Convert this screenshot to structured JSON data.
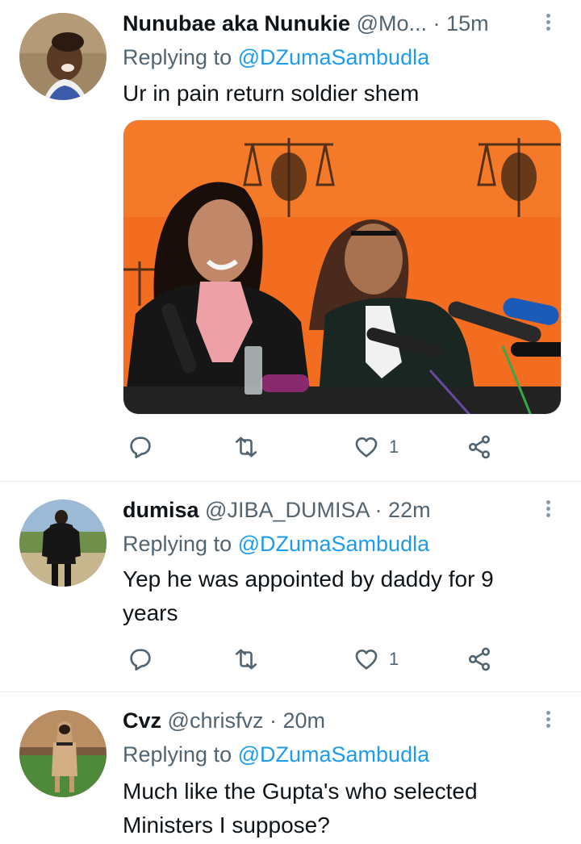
{
  "tweets": [
    {
      "name": "Nunubae aka Nunukie",
      "handle": "@Mo...",
      "dot": " ·",
      "time": "15m",
      "replying_prefix": "Replying to ",
      "replying_to": "@DZumaSambudla",
      "text": "Ur in pain return soldier shem",
      "has_media": true,
      "likes": "1"
    },
    {
      "name": "dumisa",
      "handle": "@JIBA_DUMISA",
      "dot": " ·",
      "time": "22m",
      "replying_prefix": "Replying to ",
      "replying_to": "@DZumaSambudla",
      "text": "Yep he was appointed by daddy for 9 years",
      "has_media": false,
      "likes": "1"
    },
    {
      "name": "Cvz",
      "handle": "@chrisfvz",
      "dot": " ·",
      "time": "20m",
      "replying_prefix": "Replying to ",
      "replying_to": "@DZumaSambudla",
      "text": "Much like the Gupta's who selected Ministers I suppose?",
      "has_media": false
    }
  ],
  "icons": {
    "reply": "reply-icon",
    "retweet": "retweet-icon",
    "like": "heart-icon",
    "share": "share-icon",
    "more": "more-vertical-icon"
  },
  "colors": {
    "accent": "#1d9bf0",
    "secondary_text": "#536471",
    "primary_text": "#0f1419",
    "divider": "#e6ecf0",
    "media_backdrop": "#f26d1f"
  }
}
